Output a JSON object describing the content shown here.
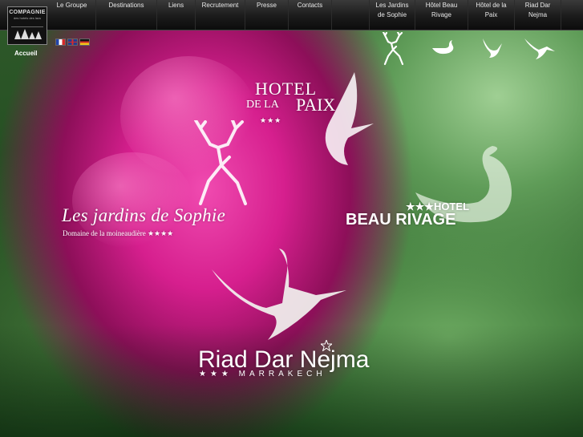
{
  "nav": {
    "items": [
      {
        "label": "Le Groupe"
      },
      {
        "label": "Destinations"
      },
      {
        "label": "Liens"
      },
      {
        "label": "Recrutement"
      },
      {
        "label": "Presse"
      },
      {
        "label": "Contacts"
      }
    ],
    "hotels": [
      {
        "line1": "Les Jardins",
        "line2": "de Sophie"
      },
      {
        "line1": "Hôtel Beau",
        "line2": "Rivage"
      },
      {
        "line1": "Hôtel de la",
        "line2": "Paix"
      },
      {
        "line1": "Riad Dar",
        "line2": "Nejma"
      }
    ]
  },
  "logo": {
    "line1": "COMPAGNIE",
    "line2": "des hotels des lacs"
  },
  "home_label": "Accueil",
  "languages": [
    "fr",
    "en",
    "de"
  ],
  "brands": {
    "hotel_de_la_paix": {
      "hotel": "HOTEL",
      "de_la": "DE LA",
      "paix": "PAIX",
      "stars": "★★★"
    },
    "jardins_de_sophie": {
      "title": "Les jardins de Sophie",
      "subtitle": "Domaine de la moineaudière ★★★★"
    },
    "beau_rivage": {
      "hotel": "★★★HOTEL",
      "name": "BEAU RIVAGE"
    },
    "riad_dar_nejma": {
      "title": "Riad Dar Nejma",
      "subtitle": "★★★ MARRAKECH"
    }
  },
  "icons": [
    "deer-icon",
    "swan-icon",
    "dove-icon",
    "crane-icon"
  ],
  "colors": {
    "nav_bg": "#1b1b1b",
    "flower": "#d61f8e",
    "leaf": "#5f9c58"
  }
}
